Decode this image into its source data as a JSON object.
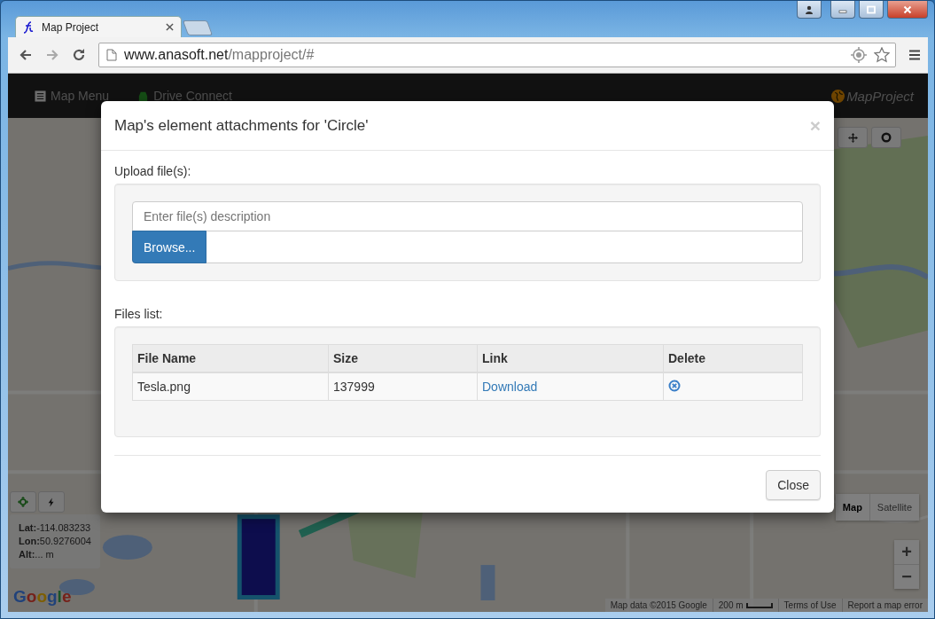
{
  "browser": {
    "tabs": [
      {
        "title": "Map Project",
        "selected": true
      }
    ],
    "url_host": "www.anasoft.net",
    "url_path": "/mapproject/#"
  },
  "navbar": {
    "items": [
      "Map Menu",
      "Drive Connect"
    ],
    "brand": "MapProject"
  },
  "map": {
    "coordinates": [
      "**Lat:**-114.083233",
      "**Lon:**50.9276004",
      "**Alt:**... m"
    ],
    "map_types": [
      {
        "label": "Map",
        "selected": true
      },
      {
        "label": "Satellite",
        "selected": false
      }
    ],
    "zoom": [
      "+",
      "−"
    ],
    "attribution": [
      "Map data ©2015 Google",
      "200 m",
      "Terms of Use",
      "Report a map error"
    ],
    "logo": "Google"
  },
  "modal": {
    "title": "Map's element attachments for 'Circle'",
    "close_symbol": "×",
    "upload_label": "Upload file(s):",
    "description": {
      "placeholder": "Enter file(s) description"
    },
    "browse_button": "Browse...",
    "files_label": "Files list:",
    "table": {
      "columns": [
        "File Name",
        "Size",
        "Link",
        "Delete"
      ],
      "rows": [
        {
          "file_name": "Tesla.png",
          "size": "137999",
          "link": "Download"
        }
      ]
    },
    "close_button": "Close"
  }
}
